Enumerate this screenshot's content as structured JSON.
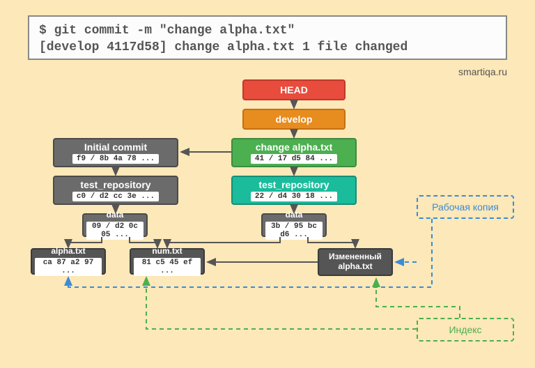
{
  "terminal": {
    "line1": "$ git commit -m \"change alpha.txt\"",
    "line2": "[develop 4117d58] change alpha.txt 1 file changed"
  },
  "watermark": "smartiqa.ru",
  "nodes": {
    "head": {
      "title": "HEAD"
    },
    "develop": {
      "title": "develop"
    },
    "change_alpha": {
      "title": "change alpha.txt",
      "hash": "41 / 17 d5 84 ..."
    },
    "test_repo_r": {
      "title": "test_repository",
      "hash": "22 / d4 30 18 ..."
    },
    "data_r": {
      "title": "data",
      "hash": "3b / 95 bc d6 ..."
    },
    "changed_alpha": {
      "title1": "Измененный",
      "title2": "alpha.txt"
    },
    "initial_commit": {
      "title": "Initial commit",
      "hash": "f9 / 8b 4a 78 ..."
    },
    "test_repo_l": {
      "title": "test_repository",
      "hash": "c0 / d2 cc 3e ..."
    },
    "data_l": {
      "title": "data",
      "hash": "09 / d2 0c 05 ..."
    },
    "alpha_txt": {
      "title": "alpha.txt",
      "hash": "ca 87 a2 97 ..."
    },
    "num_txt": {
      "title": "num.txt",
      "hash": "81 c5 45 ef ..."
    }
  },
  "labels": {
    "working_copy": "Рабочая копия",
    "index": "Индекс"
  }
}
